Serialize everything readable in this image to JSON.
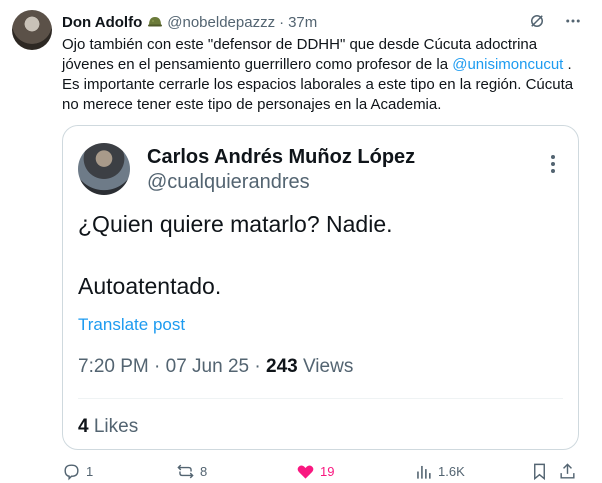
{
  "tweet": {
    "author_name": "Don Adolfo",
    "badge_icon": "helmet-emoji",
    "handle": "@nobeldepazzz",
    "separator": "·",
    "time": "37m",
    "text_before": "Ojo también con este \"defensor de DDHH\" que desde Cúcuta adoctrina jóvenes en el pensamiento guerrillero como profesor de la ",
    "mention": "@unisimoncucut",
    "text_after": " . Es importante cerrarle los espacios laborales a este tipo en la región. Cúcuta no merece tener este tipo de personajes en la Academia."
  },
  "quote": {
    "author_name": "Carlos Andrés Muñoz López",
    "handle": "@cualquierandres",
    "text_line1": "¿Quien quiere matarlo? Nadie.",
    "text_line2": "Autoatentado.",
    "translate_label": "Translate post",
    "meta_time": "7:20 PM · 07 Jun 25 · ",
    "views_count": "243",
    "views_label": " Views",
    "likes_count": "4",
    "likes_label": " Likes"
  },
  "actions": {
    "replies": "1",
    "reposts": "8",
    "likes": "19",
    "views": "1.6K"
  },
  "colors": {
    "accent": "#1d9bf0",
    "like": "#f91880",
    "muted": "#536471",
    "border": "#cfd9de"
  }
}
